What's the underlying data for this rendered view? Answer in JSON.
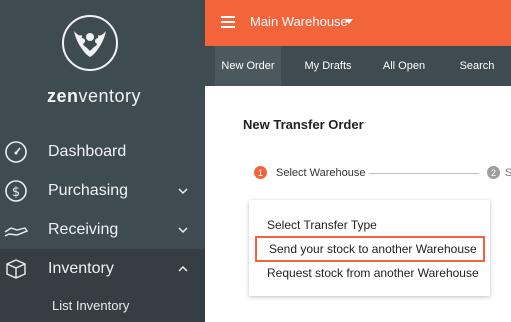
{
  "sidebar": {
    "logo_text_bold": "zen",
    "logo_text_light": "ventory",
    "items": [
      {
        "label": "Dashboard",
        "icon": "dashboard-gauge-icon",
        "has_chevron": false
      },
      {
        "label": "Purchasing",
        "icon": "dollar-circle-icon",
        "has_chevron": true,
        "chevron": "down"
      },
      {
        "label": "Receiving",
        "icon": "hand-receive-icon",
        "has_chevron": true,
        "chevron": "down"
      },
      {
        "label": "Inventory",
        "icon": "box-icon",
        "has_chevron": true,
        "chevron": "up",
        "active": true
      }
    ],
    "sub_items": [
      {
        "label": "List Inventory"
      }
    ]
  },
  "topbar": {
    "warehouse_label": "Main Warehouse",
    "bg_color": "#f3643b"
  },
  "tabs": [
    {
      "label": "New Order",
      "active": true
    },
    {
      "label": "My Drafts",
      "active": false
    },
    {
      "label": "All Open",
      "active": false
    },
    {
      "label": "Search",
      "active": false
    }
  ],
  "main": {
    "title": "New Transfer Order",
    "steps": [
      {
        "number": "1",
        "label": "Select Warehouse",
        "active": true
      },
      {
        "number": "2",
        "label": "S",
        "active": false
      }
    ],
    "menu": {
      "items": [
        {
          "label": "Select Transfer Type",
          "highlighted": false
        },
        {
          "label": "Send your stock to another Warehouse",
          "highlighted": true
        },
        {
          "label": "Request stock from another Warehouse",
          "highlighted": false
        }
      ]
    }
  },
  "colors": {
    "accent": "#f3643b",
    "sidebar": "#3e4b50",
    "step_inactive": "#9e9e9e"
  }
}
